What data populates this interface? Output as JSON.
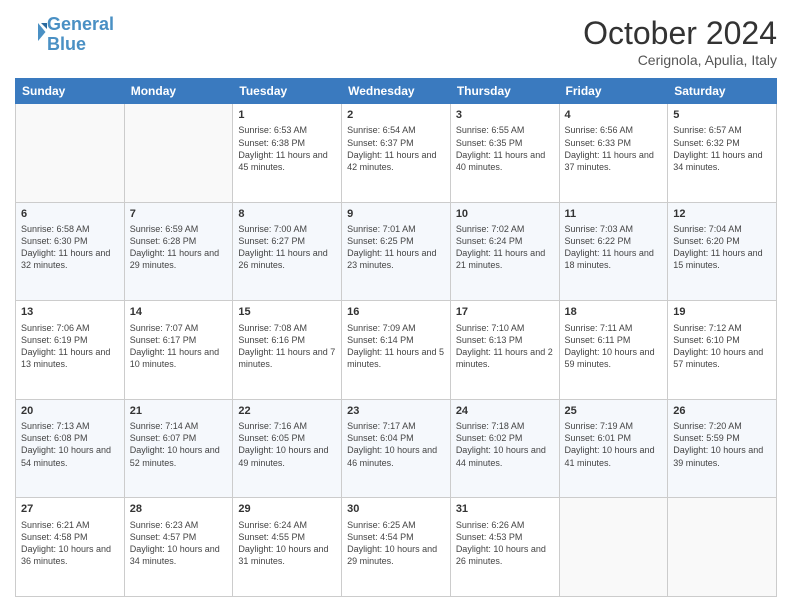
{
  "logo": {
    "line1": "General",
    "line2": "Blue"
  },
  "header": {
    "month": "October 2024",
    "location": "Cerignola, Apulia, Italy"
  },
  "days_of_week": [
    "Sunday",
    "Monday",
    "Tuesday",
    "Wednesday",
    "Thursday",
    "Friday",
    "Saturday"
  ],
  "weeks": [
    [
      {
        "day": "",
        "info": ""
      },
      {
        "day": "",
        "info": ""
      },
      {
        "day": "1",
        "info": "Sunrise: 6:53 AM\nSunset: 6:38 PM\nDaylight: 11 hours and 45 minutes."
      },
      {
        "day": "2",
        "info": "Sunrise: 6:54 AM\nSunset: 6:37 PM\nDaylight: 11 hours and 42 minutes."
      },
      {
        "day": "3",
        "info": "Sunrise: 6:55 AM\nSunset: 6:35 PM\nDaylight: 11 hours and 40 minutes."
      },
      {
        "day": "4",
        "info": "Sunrise: 6:56 AM\nSunset: 6:33 PM\nDaylight: 11 hours and 37 minutes."
      },
      {
        "day": "5",
        "info": "Sunrise: 6:57 AM\nSunset: 6:32 PM\nDaylight: 11 hours and 34 minutes."
      }
    ],
    [
      {
        "day": "6",
        "info": "Sunrise: 6:58 AM\nSunset: 6:30 PM\nDaylight: 11 hours and 32 minutes."
      },
      {
        "day": "7",
        "info": "Sunrise: 6:59 AM\nSunset: 6:28 PM\nDaylight: 11 hours and 29 minutes."
      },
      {
        "day": "8",
        "info": "Sunrise: 7:00 AM\nSunset: 6:27 PM\nDaylight: 11 hours and 26 minutes."
      },
      {
        "day": "9",
        "info": "Sunrise: 7:01 AM\nSunset: 6:25 PM\nDaylight: 11 hours and 23 minutes."
      },
      {
        "day": "10",
        "info": "Sunrise: 7:02 AM\nSunset: 6:24 PM\nDaylight: 11 hours and 21 minutes."
      },
      {
        "day": "11",
        "info": "Sunrise: 7:03 AM\nSunset: 6:22 PM\nDaylight: 11 hours and 18 minutes."
      },
      {
        "day": "12",
        "info": "Sunrise: 7:04 AM\nSunset: 6:20 PM\nDaylight: 11 hours and 15 minutes."
      }
    ],
    [
      {
        "day": "13",
        "info": "Sunrise: 7:06 AM\nSunset: 6:19 PM\nDaylight: 11 hours and 13 minutes."
      },
      {
        "day": "14",
        "info": "Sunrise: 7:07 AM\nSunset: 6:17 PM\nDaylight: 11 hours and 10 minutes."
      },
      {
        "day": "15",
        "info": "Sunrise: 7:08 AM\nSunset: 6:16 PM\nDaylight: 11 hours and 7 minutes."
      },
      {
        "day": "16",
        "info": "Sunrise: 7:09 AM\nSunset: 6:14 PM\nDaylight: 11 hours and 5 minutes."
      },
      {
        "day": "17",
        "info": "Sunrise: 7:10 AM\nSunset: 6:13 PM\nDaylight: 11 hours and 2 minutes."
      },
      {
        "day": "18",
        "info": "Sunrise: 7:11 AM\nSunset: 6:11 PM\nDaylight: 10 hours and 59 minutes."
      },
      {
        "day": "19",
        "info": "Sunrise: 7:12 AM\nSunset: 6:10 PM\nDaylight: 10 hours and 57 minutes."
      }
    ],
    [
      {
        "day": "20",
        "info": "Sunrise: 7:13 AM\nSunset: 6:08 PM\nDaylight: 10 hours and 54 minutes."
      },
      {
        "day": "21",
        "info": "Sunrise: 7:14 AM\nSunset: 6:07 PM\nDaylight: 10 hours and 52 minutes."
      },
      {
        "day": "22",
        "info": "Sunrise: 7:16 AM\nSunset: 6:05 PM\nDaylight: 10 hours and 49 minutes."
      },
      {
        "day": "23",
        "info": "Sunrise: 7:17 AM\nSunset: 6:04 PM\nDaylight: 10 hours and 46 minutes."
      },
      {
        "day": "24",
        "info": "Sunrise: 7:18 AM\nSunset: 6:02 PM\nDaylight: 10 hours and 44 minutes."
      },
      {
        "day": "25",
        "info": "Sunrise: 7:19 AM\nSunset: 6:01 PM\nDaylight: 10 hours and 41 minutes."
      },
      {
        "day": "26",
        "info": "Sunrise: 7:20 AM\nSunset: 5:59 PM\nDaylight: 10 hours and 39 minutes."
      }
    ],
    [
      {
        "day": "27",
        "info": "Sunrise: 6:21 AM\nSunset: 4:58 PM\nDaylight: 10 hours and 36 minutes."
      },
      {
        "day": "28",
        "info": "Sunrise: 6:23 AM\nSunset: 4:57 PM\nDaylight: 10 hours and 34 minutes."
      },
      {
        "day": "29",
        "info": "Sunrise: 6:24 AM\nSunset: 4:55 PM\nDaylight: 10 hours and 31 minutes."
      },
      {
        "day": "30",
        "info": "Sunrise: 6:25 AM\nSunset: 4:54 PM\nDaylight: 10 hours and 29 minutes."
      },
      {
        "day": "31",
        "info": "Sunrise: 6:26 AM\nSunset: 4:53 PM\nDaylight: 10 hours and 26 minutes."
      },
      {
        "day": "",
        "info": ""
      },
      {
        "day": "",
        "info": ""
      }
    ]
  ]
}
